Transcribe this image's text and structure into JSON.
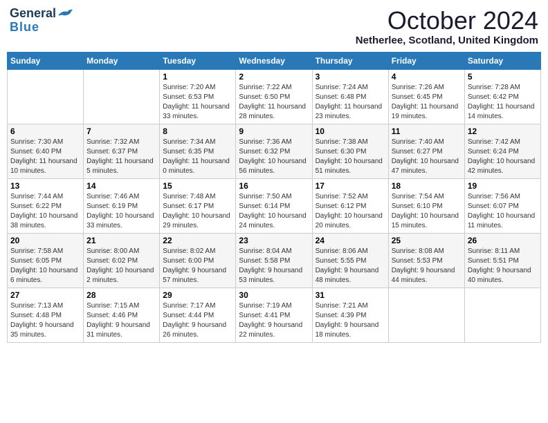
{
  "header": {
    "logo_general": "General",
    "logo_blue": "Blue",
    "month": "October 2024",
    "location": "Netherlee, Scotland, United Kingdom"
  },
  "weekdays": [
    "Sunday",
    "Monday",
    "Tuesday",
    "Wednesday",
    "Thursday",
    "Friday",
    "Saturday"
  ],
  "weeks": [
    [
      {
        "day": "",
        "info": ""
      },
      {
        "day": "",
        "info": ""
      },
      {
        "day": "1",
        "info": "Sunrise: 7:20 AM\nSunset: 6:53 PM\nDaylight: 11 hours\nand 33 minutes."
      },
      {
        "day": "2",
        "info": "Sunrise: 7:22 AM\nSunset: 6:50 PM\nDaylight: 11 hours\nand 28 minutes."
      },
      {
        "day": "3",
        "info": "Sunrise: 7:24 AM\nSunset: 6:48 PM\nDaylight: 11 hours\nand 23 minutes."
      },
      {
        "day": "4",
        "info": "Sunrise: 7:26 AM\nSunset: 6:45 PM\nDaylight: 11 hours\nand 19 minutes."
      },
      {
        "day": "5",
        "info": "Sunrise: 7:28 AM\nSunset: 6:42 PM\nDaylight: 11 hours\nand 14 minutes."
      }
    ],
    [
      {
        "day": "6",
        "info": "Sunrise: 7:30 AM\nSunset: 6:40 PM\nDaylight: 11 hours\nand 10 minutes."
      },
      {
        "day": "7",
        "info": "Sunrise: 7:32 AM\nSunset: 6:37 PM\nDaylight: 11 hours\nand 5 minutes."
      },
      {
        "day": "8",
        "info": "Sunrise: 7:34 AM\nSunset: 6:35 PM\nDaylight: 11 hours\nand 0 minutes."
      },
      {
        "day": "9",
        "info": "Sunrise: 7:36 AM\nSunset: 6:32 PM\nDaylight: 10 hours\nand 56 minutes."
      },
      {
        "day": "10",
        "info": "Sunrise: 7:38 AM\nSunset: 6:30 PM\nDaylight: 10 hours\nand 51 minutes."
      },
      {
        "day": "11",
        "info": "Sunrise: 7:40 AM\nSunset: 6:27 PM\nDaylight: 10 hours\nand 47 minutes."
      },
      {
        "day": "12",
        "info": "Sunrise: 7:42 AM\nSunset: 6:24 PM\nDaylight: 10 hours\nand 42 minutes."
      }
    ],
    [
      {
        "day": "13",
        "info": "Sunrise: 7:44 AM\nSunset: 6:22 PM\nDaylight: 10 hours\nand 38 minutes."
      },
      {
        "day": "14",
        "info": "Sunrise: 7:46 AM\nSunset: 6:19 PM\nDaylight: 10 hours\nand 33 minutes."
      },
      {
        "day": "15",
        "info": "Sunrise: 7:48 AM\nSunset: 6:17 PM\nDaylight: 10 hours\nand 29 minutes."
      },
      {
        "day": "16",
        "info": "Sunrise: 7:50 AM\nSunset: 6:14 PM\nDaylight: 10 hours\nand 24 minutes."
      },
      {
        "day": "17",
        "info": "Sunrise: 7:52 AM\nSunset: 6:12 PM\nDaylight: 10 hours\nand 20 minutes."
      },
      {
        "day": "18",
        "info": "Sunrise: 7:54 AM\nSunset: 6:10 PM\nDaylight: 10 hours\nand 15 minutes."
      },
      {
        "day": "19",
        "info": "Sunrise: 7:56 AM\nSunset: 6:07 PM\nDaylight: 10 hours\nand 11 minutes."
      }
    ],
    [
      {
        "day": "20",
        "info": "Sunrise: 7:58 AM\nSunset: 6:05 PM\nDaylight: 10 hours\nand 6 minutes."
      },
      {
        "day": "21",
        "info": "Sunrise: 8:00 AM\nSunset: 6:02 PM\nDaylight: 10 hours\nand 2 minutes."
      },
      {
        "day": "22",
        "info": "Sunrise: 8:02 AM\nSunset: 6:00 PM\nDaylight: 9 hours\nand 57 minutes."
      },
      {
        "day": "23",
        "info": "Sunrise: 8:04 AM\nSunset: 5:58 PM\nDaylight: 9 hours\nand 53 minutes."
      },
      {
        "day": "24",
        "info": "Sunrise: 8:06 AM\nSunset: 5:55 PM\nDaylight: 9 hours\nand 48 minutes."
      },
      {
        "day": "25",
        "info": "Sunrise: 8:08 AM\nSunset: 5:53 PM\nDaylight: 9 hours\nand 44 minutes."
      },
      {
        "day": "26",
        "info": "Sunrise: 8:11 AM\nSunset: 5:51 PM\nDaylight: 9 hours\nand 40 minutes."
      }
    ],
    [
      {
        "day": "27",
        "info": "Sunrise: 7:13 AM\nSunset: 4:48 PM\nDaylight: 9 hours\nand 35 minutes."
      },
      {
        "day": "28",
        "info": "Sunrise: 7:15 AM\nSunset: 4:46 PM\nDaylight: 9 hours\nand 31 minutes."
      },
      {
        "day": "29",
        "info": "Sunrise: 7:17 AM\nSunset: 4:44 PM\nDaylight: 9 hours\nand 26 minutes."
      },
      {
        "day": "30",
        "info": "Sunrise: 7:19 AM\nSunset: 4:41 PM\nDaylight: 9 hours\nand 22 minutes."
      },
      {
        "day": "31",
        "info": "Sunrise: 7:21 AM\nSunset: 4:39 PM\nDaylight: 9 hours\nand 18 minutes."
      },
      {
        "day": "",
        "info": ""
      },
      {
        "day": "",
        "info": ""
      }
    ]
  ]
}
